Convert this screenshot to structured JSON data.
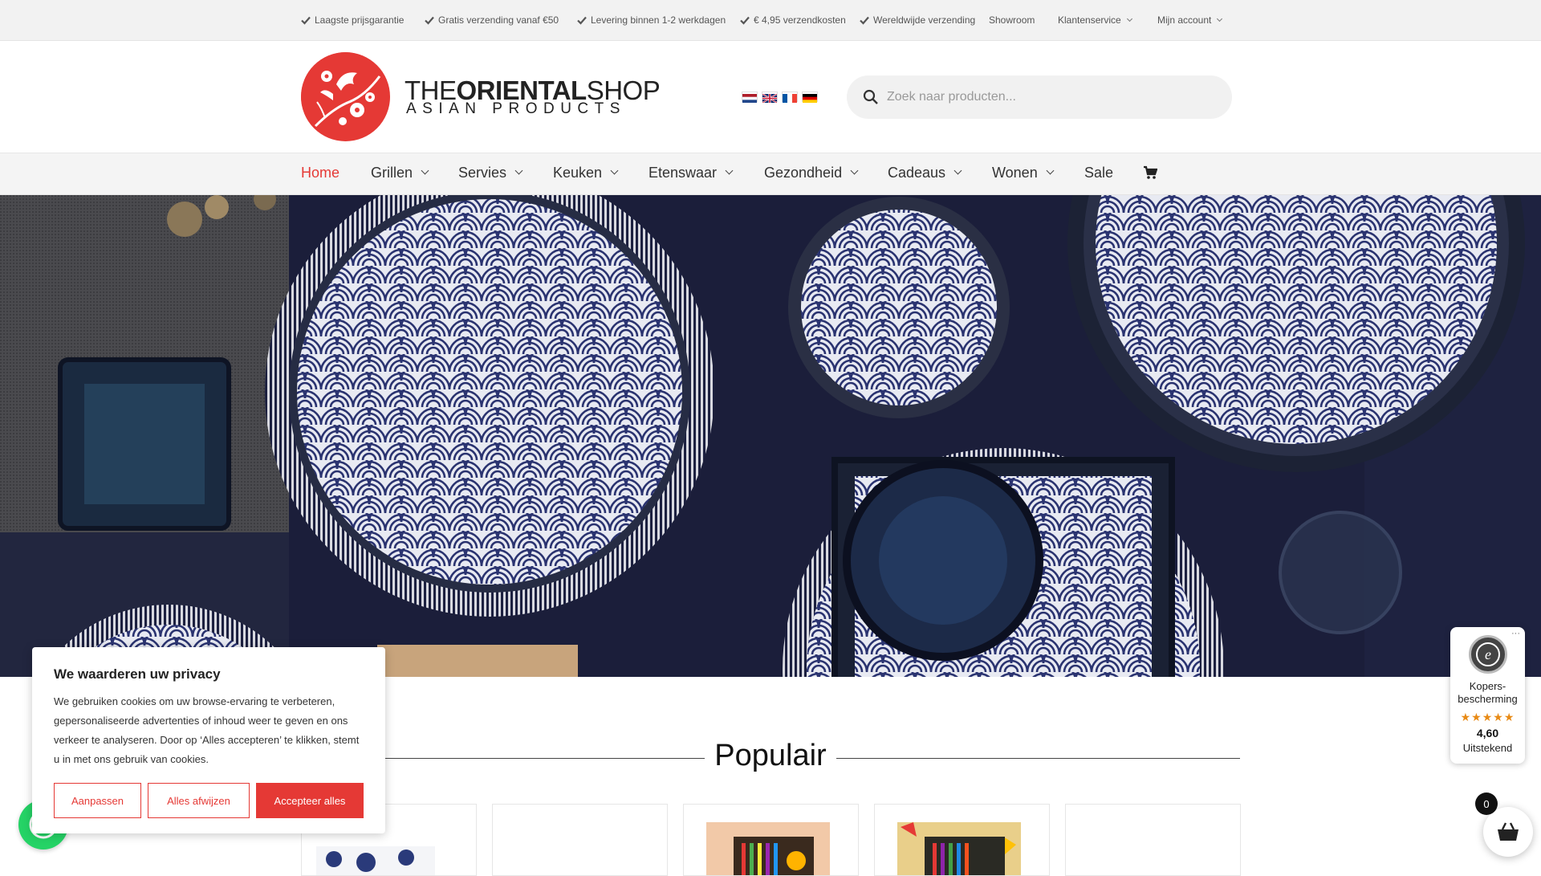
{
  "topbar": {
    "usps": [
      "Laagste prijsgarantie",
      "Gratis verzending vanaf €50",
      "Levering binnen 1-2 werkdagen",
      "€ 4,95 verzendkosten",
      "Wereldwijde verzending"
    ],
    "showroom": "Showroom",
    "customer_service": "Klantenservice",
    "account": "Mijn account"
  },
  "logo": {
    "line1_a": "THE",
    "line1_b": "ORIENTAL",
    "line1_c": "SHOP",
    "line2": "ASIAN PRODUCTS",
    "brand_color": "#e53935"
  },
  "languages": [
    "nl",
    "en",
    "fr",
    "de"
  ],
  "search": {
    "placeholder": "Zoek naar producten..."
  },
  "nav": {
    "items": [
      {
        "label": "Home",
        "active": true,
        "dropdown": false
      },
      {
        "label": "Grillen",
        "active": false,
        "dropdown": true
      },
      {
        "label": "Servies",
        "active": false,
        "dropdown": true
      },
      {
        "label": "Keuken",
        "active": false,
        "dropdown": true
      },
      {
        "label": "Etenswaar",
        "active": false,
        "dropdown": true
      },
      {
        "label": "Gezondheid",
        "active": false,
        "dropdown": true
      },
      {
        "label": "Cadeaus",
        "active": false,
        "dropdown": true
      },
      {
        "label": "Wonen",
        "active": false,
        "dropdown": true
      },
      {
        "label": "Sale",
        "active": false,
        "dropdown": false
      }
    ],
    "cart_icon": "shopping-cart-icon"
  },
  "section": {
    "title": "Populair"
  },
  "cookie": {
    "title": "We waarderen uw privacy",
    "text": "We gebruiken cookies om uw browse-ervaring te verbeteren, gepersonaliseerde advertenties of inhoud weer te geven en ons verkeer te analyseren. Door op ‘Alles accepteren’ te klikken, stemt u in met ons gebruik van cookies.",
    "customize": "Aanpassen",
    "reject": "Alles afwijzen",
    "accept": "Accepteer alles"
  },
  "trust": {
    "label": "Kopers-bescherming",
    "label_line1": "Kopers-",
    "label_line2": "bescherming",
    "stars": "★★★★★",
    "rating": 4.6,
    "score": "4,60",
    "word": "Uitstekend",
    "more": "···"
  },
  "cart": {
    "count": "0"
  }
}
